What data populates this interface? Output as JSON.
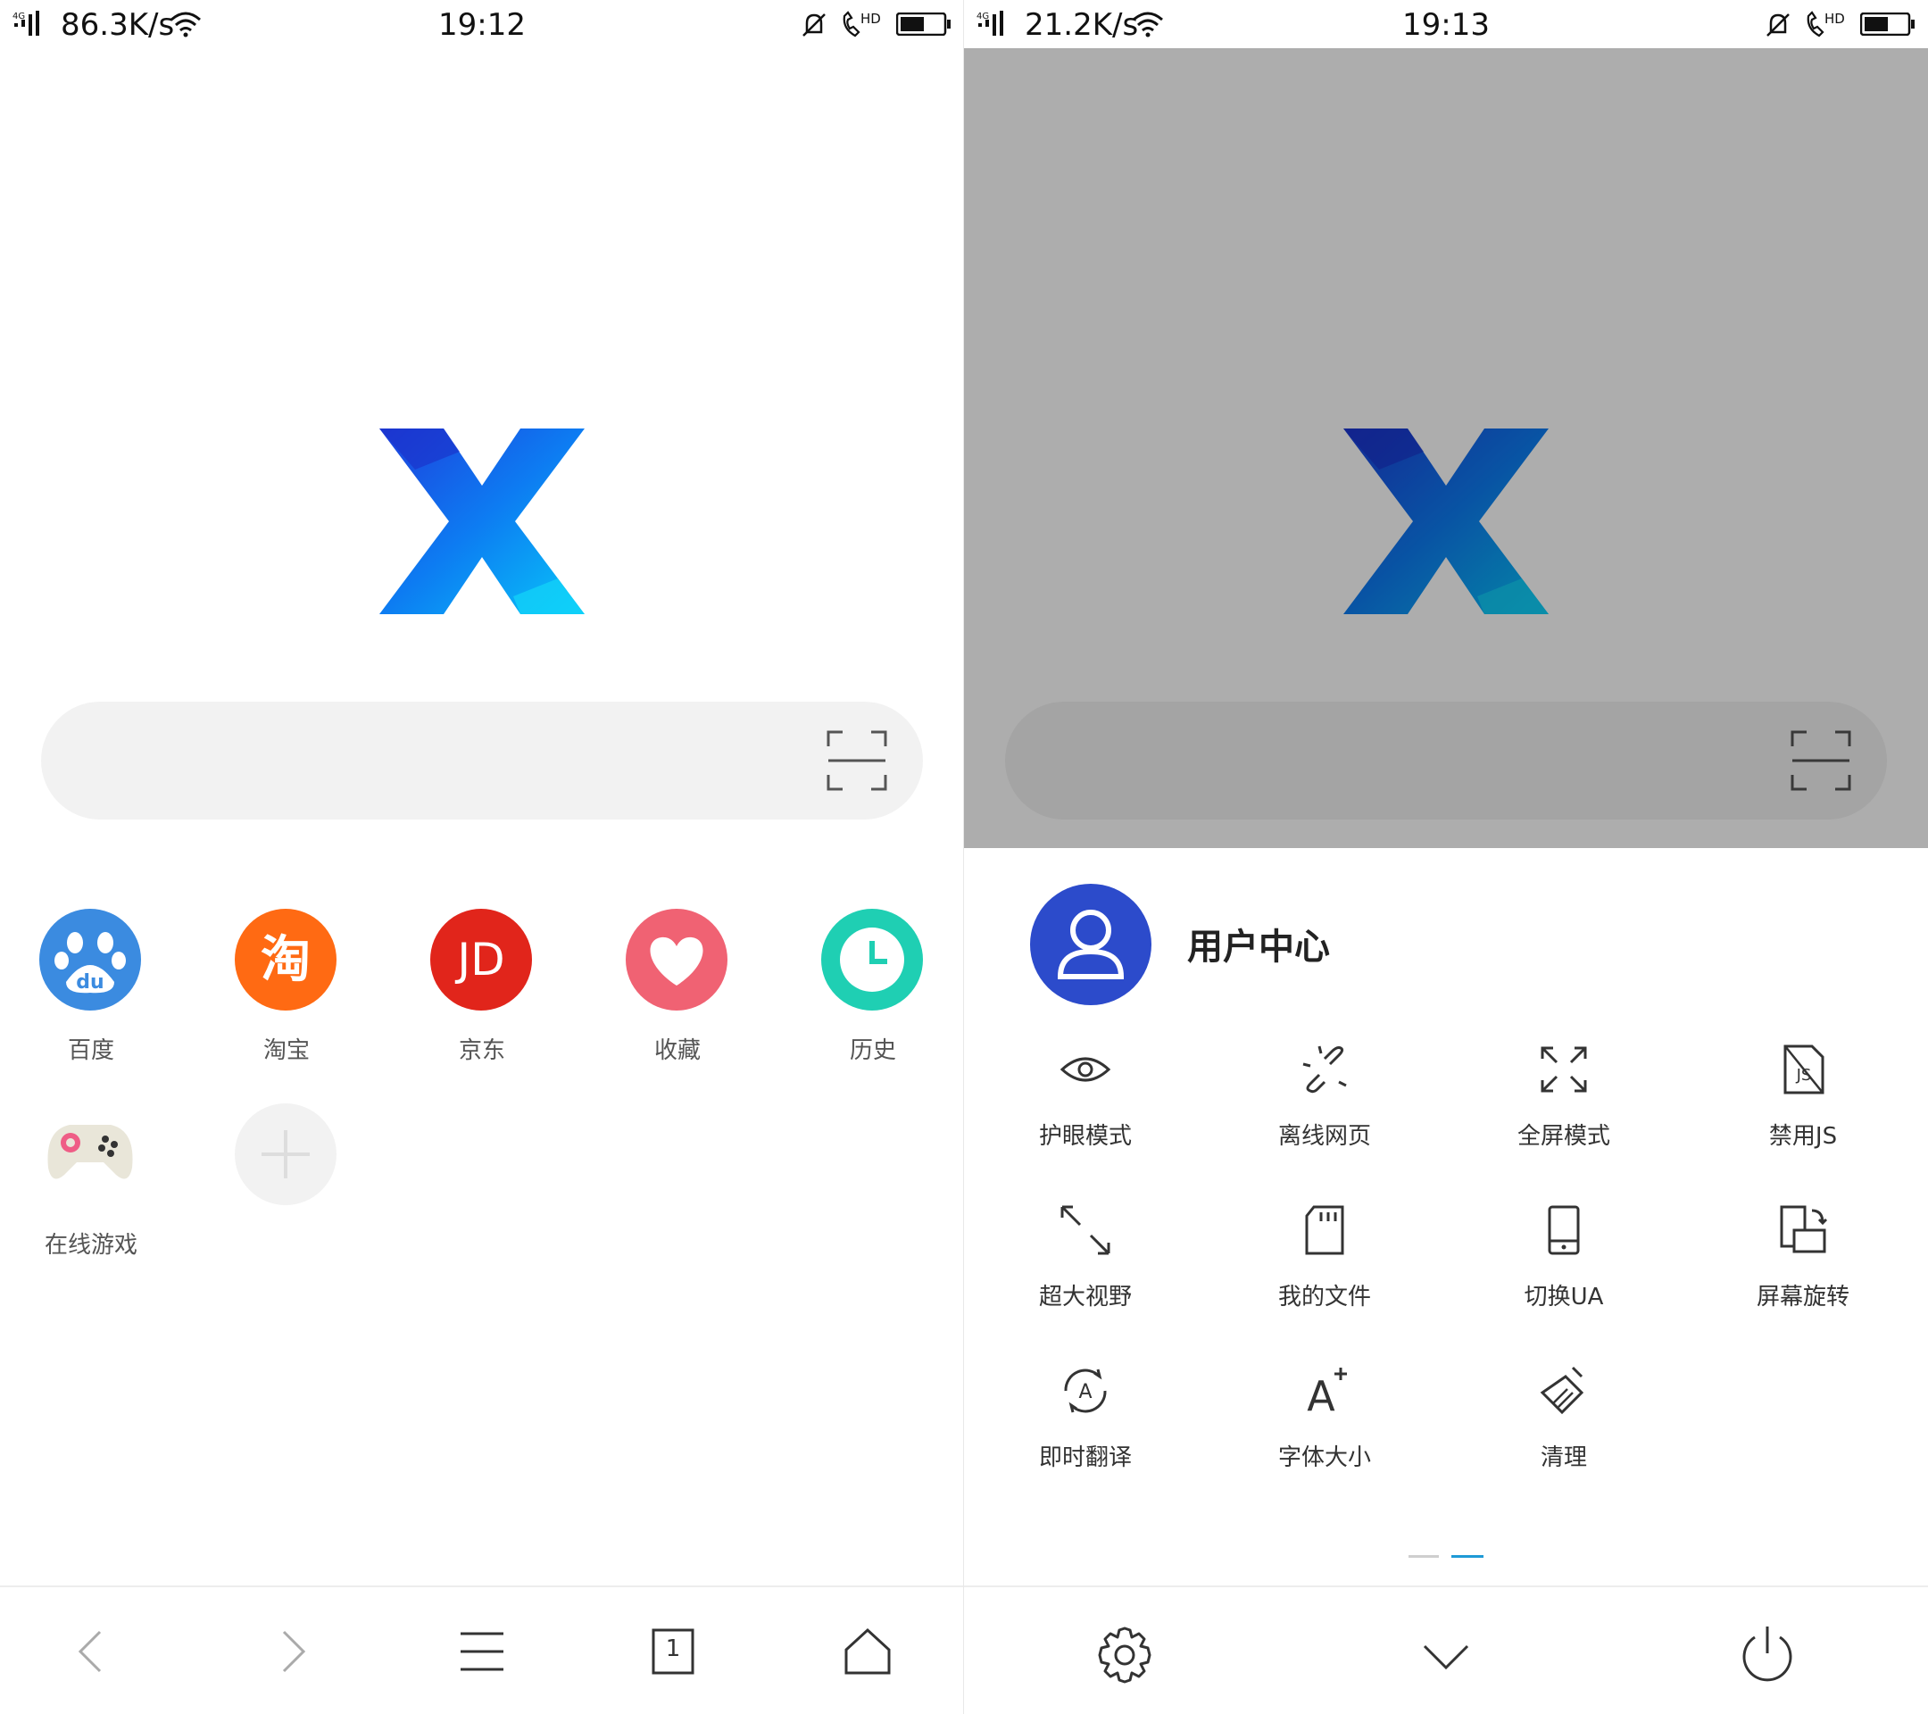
{
  "left": {
    "status": {
      "speed": "86.3K/s",
      "time": "19:12"
    },
    "search": {
      "placeholder": ""
    },
    "shortcuts": [
      {
        "label": "百度",
        "icon": "baidu-paw-icon",
        "color": "#3b8be0",
        "glyph": "du"
      },
      {
        "label": "淘宝",
        "icon": "taobao-icon",
        "color": "#ff6a13",
        "glyph": "淘"
      },
      {
        "label": "京东",
        "icon": "jd-icon",
        "color": "#e1251b",
        "glyph": "JD"
      },
      {
        "label": "收藏",
        "icon": "heart-icon",
        "color": "#f06273",
        "glyph": ""
      },
      {
        "label": "历史",
        "icon": "clock-icon",
        "color": "#1fcfb3",
        "glyph": ""
      },
      {
        "label": "在线游戏",
        "icon": "gamepad-icon",
        "color": "#e9e6d9",
        "glyph": ""
      },
      {
        "label": "",
        "icon": "plus-icon",
        "color": "#f2f2f2",
        "glyph": ""
      }
    ],
    "nav": {
      "tab_count": "1"
    }
  },
  "right": {
    "status": {
      "speed": "21.2K/s",
      "time": "19:13"
    },
    "user_center": "用户中心",
    "tools": [
      {
        "label": "护眼模式",
        "icon": "eye-icon"
      },
      {
        "label": "离线网页",
        "icon": "offline-link-icon"
      },
      {
        "label": "全屏模式",
        "icon": "fullscreen-icon"
      },
      {
        "label": "禁用JS",
        "icon": "js-disabled-icon"
      },
      {
        "label": "超大视野",
        "icon": "expand-diagonal-icon"
      },
      {
        "label": "我的文件",
        "icon": "sd-card-icon"
      },
      {
        "label": "切换UA",
        "icon": "phone-icon"
      },
      {
        "label": "屏幕旋转",
        "icon": "screen-rotate-icon"
      },
      {
        "label": "即时翻译",
        "icon": "translate-icon"
      },
      {
        "label": "字体大小",
        "icon": "font-size-icon"
      },
      {
        "label": "清理",
        "icon": "broom-icon"
      }
    ],
    "page_indicator": {
      "pages": 2,
      "active": 2
    }
  },
  "colors": {
    "accent": "#2c4bcb",
    "indicator_active": "#1e9ad6",
    "dim": "rgba(0,0,0,0.32)"
  }
}
